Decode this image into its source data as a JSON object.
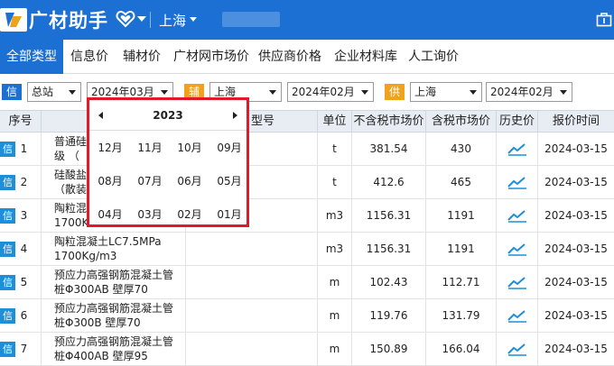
{
  "title_bar": {
    "app_name": "广材助手",
    "city": "上海",
    "icons": [
      "logo-icon",
      "heart-icon",
      "chevron-down-icon",
      "bag-icon"
    ]
  },
  "nav": {
    "tabs": [
      "全部类型",
      "信息价",
      "辅材价",
      "广材网市场价",
      "供应商价格",
      "企业材料库",
      "人工询价"
    ]
  },
  "filters": {
    "xin_tag": "信",
    "fu_tag": "辅",
    "gong_tag": "供",
    "region1": "总站",
    "date1": "2024年03月",
    "region2": "上海",
    "date2": "2024年02月",
    "region3": "上海",
    "date3": "2024年02月",
    "colors": {
      "xin": "#1c6fd3",
      "fu": "#f0a21d",
      "gong": "#f0a21d"
    }
  },
  "table": {
    "headers": {
      "seq": "序号",
      "model_partial": "型号",
      "unit": "单位",
      "price_ex": "不含税市场价",
      "price_in": "含税市场价",
      "history": "历史价",
      "date": "报价时间"
    },
    "rows": [
      {
        "tag": "信",
        "seq": "1",
        "name1": "普通硅",
        "name2": "级 （",
        "unit": "t",
        "price_ex": "381.54",
        "price_in": "430",
        "date": "2024-03-15"
      },
      {
        "tag": "信",
        "seq": "2",
        "name1": "硅酸盐",
        "name2": "（散装",
        "unit": "t",
        "price_ex": "412.6",
        "price_in": "465",
        "date": "2024-03-15"
      },
      {
        "tag": "信",
        "seq": "3",
        "name1": "陶粒混",
        "name2": "1700K",
        "unit": "m3",
        "price_ex": "1156.31",
        "price_in": "1191",
        "date": "2024-03-15"
      },
      {
        "tag": "信",
        "seq": "4",
        "name1": "陶粒混凝土LC7.5MPa",
        "name2": "1700Kg/m3",
        "unit": "m3",
        "price_ex": "1156.31",
        "price_in": "1191",
        "date": "2024-03-15"
      },
      {
        "tag": "信",
        "seq": "5",
        "name1": "预应力高强钢筋混凝土管",
        "name2": "桩Φ300AB 壁厚70",
        "unit": "m",
        "price_ex": "102.43",
        "price_in": "112.71",
        "date": "2024-03-15"
      },
      {
        "tag": "信",
        "seq": "6",
        "name1": "预应力高强钢筋混凝土管",
        "name2": "桩Φ300B 壁厚70",
        "unit": "m",
        "price_ex": "119.76",
        "price_in": "131.79",
        "date": "2024-03-15"
      },
      {
        "tag": "信",
        "seq": "7",
        "name1": "预应力高强钢筋混凝土管",
        "name2": "桩Φ400AB 壁厚95",
        "unit": "m",
        "price_ex": "150.89",
        "price_in": "166.04",
        "date": "2024-03-15"
      }
    ]
  },
  "month_picker": {
    "year": "2023",
    "months": [
      "12月",
      "11月",
      "10月",
      "09月",
      "08月",
      "07月",
      "06月",
      "05月",
      "04月",
      "03月",
      "02月",
      "01月"
    ]
  }
}
